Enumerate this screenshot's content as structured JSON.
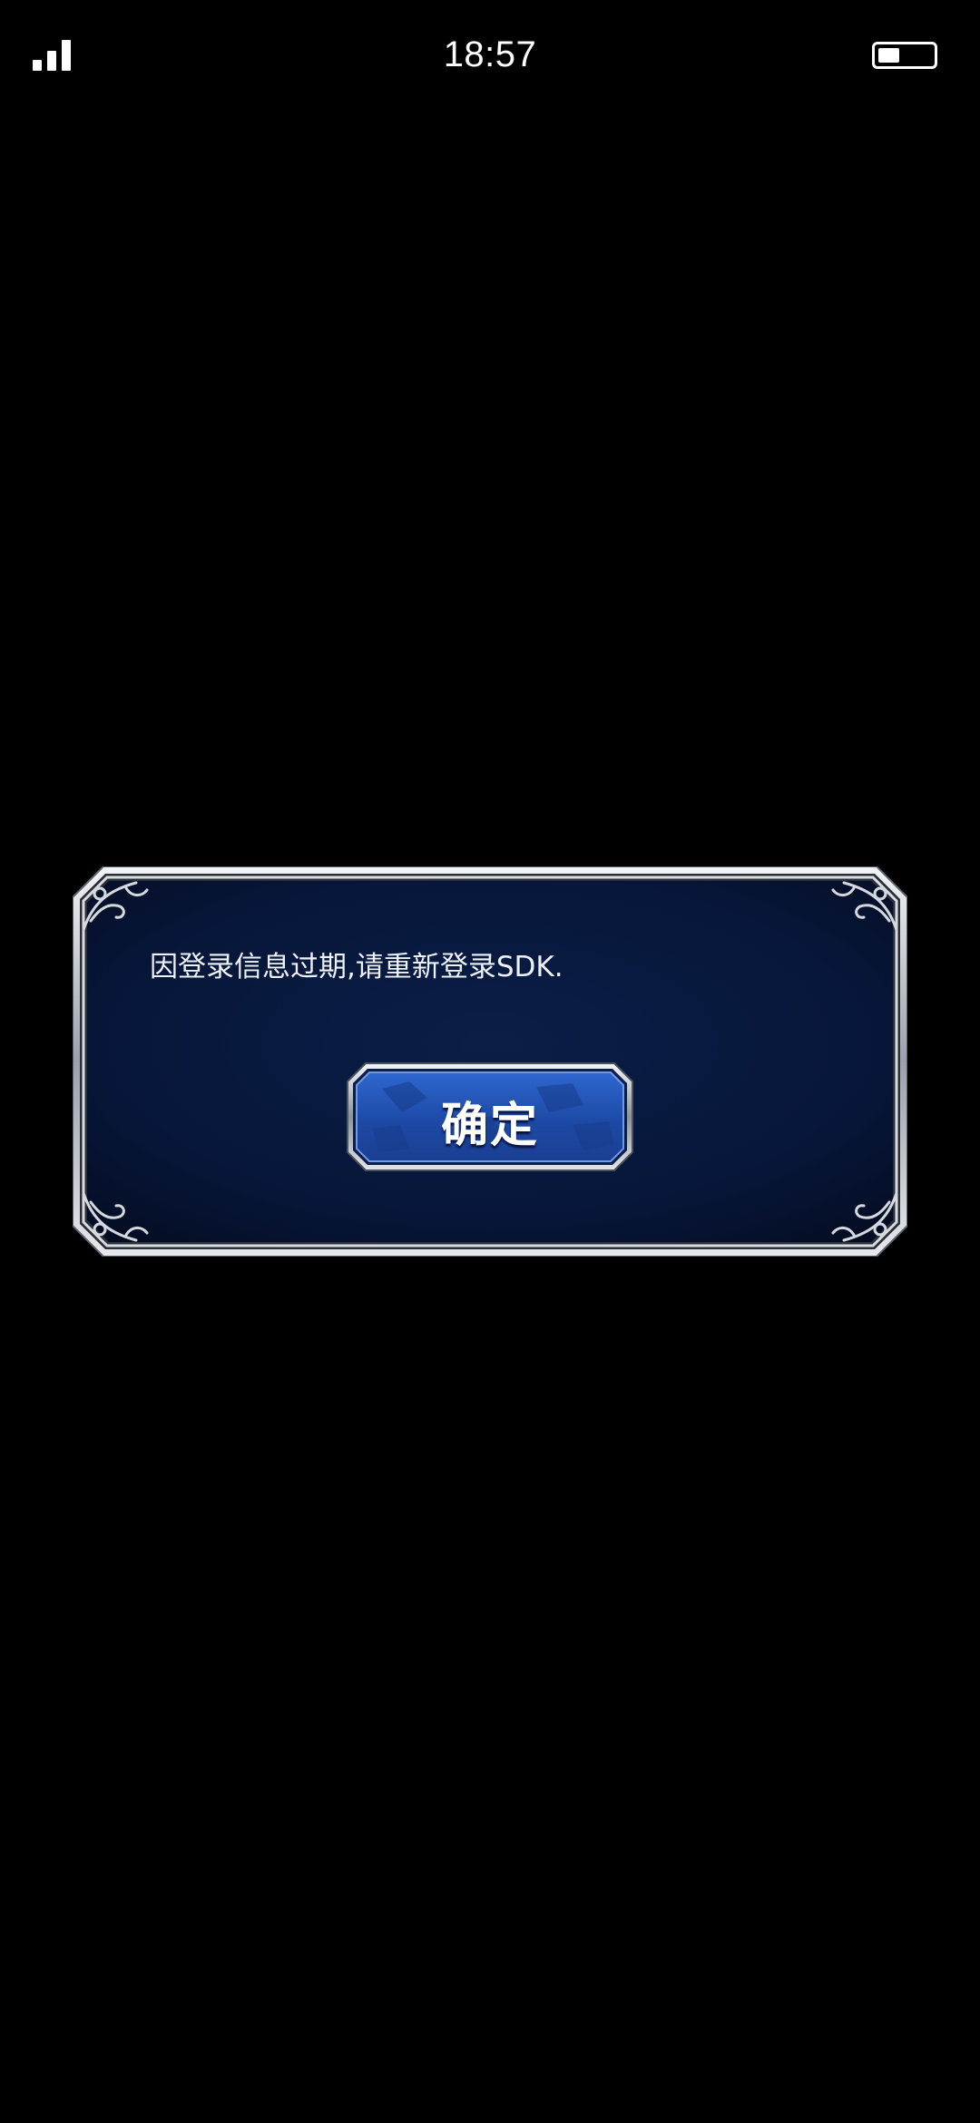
{
  "status_bar": {
    "time": "18:57",
    "signal_icon": "signal-bars-icon",
    "battery_icon": "battery-icon",
    "battery_level": 0.4
  },
  "dialog": {
    "message": "因登录信息过期,请重新登录SDK.",
    "confirm_label": "确定"
  },
  "colors": {
    "background": "#000000",
    "dialog_panel": "#07183a",
    "frame_silver": "#c8ccd2",
    "button_blue": "#1f4fb0"
  }
}
